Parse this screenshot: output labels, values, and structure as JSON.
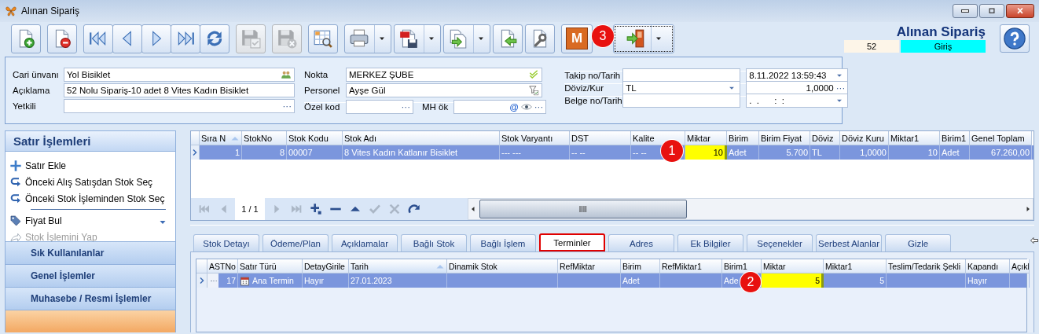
{
  "window": {
    "title": "Alınan Sipariş"
  },
  "toolbar": [
    [
      {
        "kind": "new",
        "disabled": false,
        "dropdown": false,
        "focused": false
      }
    ],
    [
      {
        "kind": "delete",
        "disabled": false,
        "dropdown": false,
        "focused": false
      }
    ],
    [
      {
        "kind": "first",
        "disabled": false,
        "dropdown": false,
        "focused": false
      },
      {
        "kind": "prev",
        "disabled": false,
        "dropdown": false,
        "focused": false
      },
      {
        "kind": "next",
        "disabled": false,
        "dropdown": false,
        "focused": false
      },
      {
        "kind": "last",
        "disabled": false,
        "dropdown": false,
        "focused": false
      },
      {
        "kind": "refresh",
        "disabled": false,
        "dropdown": false,
        "focused": false
      }
    ],
    [
      {
        "kind": "save",
        "disabled": true,
        "dropdown": false,
        "focused": false
      }
    ],
    [
      {
        "kind": "savex",
        "disabled": true,
        "dropdown": false,
        "focused": false
      }
    ],
    [
      {
        "kind": "report",
        "disabled": false,
        "dropdown": false,
        "focused": false
      }
    ],
    [
      {
        "kind": "print",
        "disabled": false,
        "dropdown": true,
        "focused": false
      }
    ],
    [
      {
        "kind": "pdf",
        "disabled": false,
        "dropdown": true,
        "focused": false
      }
    ],
    [
      {
        "kind": "export",
        "disabled": false,
        "dropdown": true,
        "focused": false
      }
    ],
    [
      {
        "kind": "import",
        "disabled": false,
        "dropdown": false,
        "focused": false
      }
    ],
    [
      {
        "kind": "tools",
        "disabled": false,
        "dropdown": false,
        "focused": false
      }
    ],
    [
      {
        "kind": "letter",
        "text": "M",
        "disabled": false,
        "dropdown": false,
        "focused": false
      }
    ],
    [
      {
        "kind": "exit",
        "disabled": false,
        "dropdown": true,
        "focused": true
      }
    ]
  ],
  "header": {
    "title": "Alınan Sipariş",
    "number": "52",
    "direction": "Giriş"
  },
  "form": {
    "columns": [
      {
        "rows": [
          {
            "label": "Cari ünvanı",
            "fields": [
              {
                "value": "Yol Bisiklet",
                "adornments": [
                  {
                    "kind": "people"
                  }
                ]
              }
            ]
          },
          {
            "label": "Açıklama",
            "fields": [
              {
                "value": "52 Nolu Sipariş-10 adet 8 Vites Kadın Bisiklet"
              }
            ]
          },
          {
            "label": "Yetkili",
            "fields": [
              {
                "adornments": [
                  {
                    "kind": "ellipsis",
                    "text": "···"
                  }
                ]
              }
            ]
          }
        ]
      },
      {
        "rows": [
          {
            "label": "Nokta",
            "fields": [
              {
                "value": "MERKEZ ŞUBE",
                "adornments": [
                  {
                    "kind": "check"
                  }
                ]
              }
            ]
          },
          {
            "label": "Personel",
            "fields": [
              {
                "value": "Ayşe Gül",
                "adornments": [
                  {
                    "kind": "filter"
                  }
                ]
              }
            ]
          },
          {
            "label": "Özel kod",
            "fields": [
              {
                "adornments": [
                  {
                    "kind": "ellipsis",
                    "text": "···"
                  }
                ]
              },
              {
                "label": "MH ök",
                "adornments": [
                  {
                    "kind": "at",
                    "text": "@"
                  },
                  {
                    "kind": "eye"
                  },
                  {
                    "kind": "ellipsis",
                    "text": "···"
                  }
                ]
              }
            ]
          }
        ]
      },
      {
        "rows": [
          {
            "label": "Takip no/Tarih",
            "fields": [
              {
                "kind": "text"
              },
              {
                "value": "8.11.2022 13:59:43",
                "adornments": [
                  {
                    "kind": "dropdown"
                  }
                ]
              }
            ]
          },
          {
            "label": "Döviz/Kur",
            "fields": [
              {
                "value": "TL",
                "adornments": [
                  {
                    "kind": "dropdown"
                  }
                ]
              },
              {
                "value": "1,0000",
                "kind": "number",
                "adornments": [
                  {
                    "kind": "ellipsis",
                    "text": "···"
                  }
                ]
              }
            ]
          },
          {
            "label": "Belge no/Tarih",
            "fields": [
              {
                "kind": "text"
              },
              {
                "value": ".  .      :  :",
                "adornments": [
                  {
                    "kind": "dropdown"
                  }
                ]
              }
            ]
          }
        ]
      }
    ]
  },
  "sidebar": {
    "title": "Satır İşlemleri",
    "item_groups": [
      [
        {
          "label": "Satır Ekle",
          "kind": "add",
          "disabled": false
        },
        {
          "label": "Önceki Alış Satışdan Stok Seç",
          "kind": "pick",
          "disabled": false
        },
        {
          "label": "Önceki Stok İşleminden Stok Seç",
          "kind": "pick",
          "disabled": false
        }
      ],
      [
        {
          "label": "Fiyat Bul",
          "kind": "price",
          "disabled": false
        },
        {
          "label": "Stok İşlemini Yap",
          "kind": "run",
          "disabled": true
        }
      ]
    ],
    "sections": [
      {
        "label": "Sık Kullanılanlar",
        "selected": false
      },
      {
        "label": "Genel İşlemler",
        "selected": false
      },
      {
        "label": "Muhasebe / Resmi İşlemler",
        "selected": false
      },
      {
        "selected": true
      }
    ]
  },
  "top_grid": {
    "columns": [
      {
        "label": "Sıra N",
        "kind": "number",
        "sorted": true
      },
      {
        "label": "StokNo",
        "kind": "number",
        "sorted": false
      },
      {
        "label": "Stok Kodu",
        "kind": "text",
        "sorted": false
      },
      {
        "label": "Stok Adı",
        "kind": "text",
        "sorted": false
      },
      {
        "label": "Stok Varyantı",
        "kind": "text",
        "sorted": false
      },
      {
        "label": "DST",
        "kind": "text",
        "sorted": false
      },
      {
        "label": "Kalite",
        "kind": "text",
        "sorted": false
      },
      {
        "label": "Miktar",
        "kind": "number",
        "sorted": false
      },
      {
        "label": "Birim",
        "kind": "text",
        "sorted": false
      },
      {
        "label": "Birim Fiyat",
        "kind": "number",
        "sorted": false
      },
      {
        "label": "Döviz",
        "kind": "text",
        "sorted": false
      },
      {
        "label": "Döviz Kuru",
        "kind": "number",
        "sorted": false
      },
      {
        "label": "Miktar1",
        "kind": "number",
        "sorted": false
      },
      {
        "label": "Birim1",
        "kind": "text",
        "sorted": false
      },
      {
        "label": "Genel Toplam",
        "kind": "number",
        "sorted": false
      }
    ],
    "rows": [
      {
        "selected": true,
        "cells": [
          {
            "text": "1",
            "highlighted": false
          },
          {
            "text": "8",
            "highlighted": false
          },
          {
            "text": "00007",
            "highlighted": false
          },
          {
            "text": "8 Vites Kadın Katlanır Bisiklet",
            "highlighted": false
          },
          {
            "text": "--- ---",
            "highlighted": false
          },
          {
            "text": "-- --",
            "highlighted": false
          },
          {
            "text": "-- --",
            "highlighted": false
          },
          {
            "text": "10",
            "highlighted": true
          },
          {
            "text": "Adet",
            "highlighted": false
          },
          {
            "text": "5.700",
            "highlighted": false
          },
          {
            "text": "TL",
            "highlighted": false
          },
          {
            "text": "1,0000",
            "highlighted": false
          },
          {
            "text": "10",
            "highlighted": false
          },
          {
            "text": "Adet",
            "highlighted": false
          },
          {
            "text": "67.260,00",
            "highlighted": false
          }
        ]
      }
    ],
    "navigator": [
      {
        "kind": "nfirst",
        "disabled": true
      },
      {
        "kind": "nprev",
        "disabled": true
      },
      {
        "kind": "page",
        "text": "1 / 1"
      },
      {
        "kind": "nnext",
        "disabled": true
      },
      {
        "kind": "nlast",
        "disabled": true
      },
      {
        "kind": "nappend",
        "disabled": false
      },
      {
        "kind": "nremove",
        "disabled": false
      },
      {
        "kind": "nup",
        "disabled": false
      },
      {
        "kind": "nconfirm",
        "disabled": true
      },
      {
        "kind": "ncancel",
        "disabled": true
      },
      {
        "kind": "nredo",
        "disabled": false
      }
    ]
  },
  "detail_tabs": [
    {
      "label": "Stok Detayı",
      "selected": false
    },
    {
      "label": "Ödeme/Plan",
      "selected": false
    },
    {
      "label": "Açıklamalar",
      "selected": false
    },
    {
      "label": "Bağlı Stok",
      "selected": false
    },
    {
      "label": "Bağlı İşlem",
      "selected": false
    },
    {
      "label": "Terminler",
      "selected": true
    },
    {
      "label": "Adres",
      "selected": false
    },
    {
      "label": "Ek Bilgiler",
      "selected": false
    },
    {
      "label": "Seçenekler",
      "selected": false
    },
    {
      "label": "Serbest Alanlar",
      "selected": false
    },
    {
      "label": "Gizle",
      "selected": false
    }
  ],
  "detail_grid": {
    "columns": [
      {
        "label": "ASTNo",
        "kind": "tree",
        "sorted": false
      },
      {
        "label": "Satır Türü",
        "kind": "entry-type",
        "sorted": false
      },
      {
        "label": "DetayGirile",
        "kind": "text",
        "sorted": false
      },
      {
        "label": "Tarih",
        "kind": "text",
        "sorted": true
      },
      {
        "label": "Dinamik Stok",
        "kind": "text",
        "sorted": false
      },
      {
        "label": "RefMiktar",
        "kind": "number",
        "sorted": false
      },
      {
        "label": "Birim",
        "kind": "text",
        "sorted": false
      },
      {
        "label": "RefMiktar1",
        "kind": "number",
        "sorted": false
      },
      {
        "label": "Birim1",
        "kind": "text",
        "sorted": false
      },
      {
        "label": "Miktar",
        "kind": "number",
        "sorted": false
      },
      {
        "label": "Miktar1",
        "kind": "number",
        "sorted": false
      },
      {
        "label": "Teslim/Tedarik Şekli",
        "kind": "text",
        "sorted": false
      },
      {
        "label": "Kapandı",
        "kind": "text",
        "sorted": false
      },
      {
        "label": "Açıkl",
        "kind": "text",
        "sorted": false
      }
    ],
    "rows": [
      {
        "selected": true,
        "cells": [
          {
            "text": "17",
            "highlighted": false
          },
          {
            "text": "Ana Termin",
            "highlighted": false
          },
          {
            "text": "Hayır",
            "highlighted": false
          },
          {
            "text": "27.01.2023",
            "highlighted": false
          },
          {
            "highlighted": false
          },
          {
            "highlighted": false
          },
          {
            "text": "Adet",
            "highlighted": false
          },
          {
            "highlighted": false
          },
          {
            "text": "Ade",
            "highlighted": false
          },
          {
            "text": "5",
            "highlighted": true
          },
          {
            "text": "5",
            "highlighted": false
          },
          {
            "highlighted": false
          },
          {
            "text": "Hayır",
            "highlighted": false
          },
          {
            "highlighted": false
          }
        ]
      }
    ]
  },
  "annotations": [
    {
      "text": "1"
    },
    {
      "text": "2"
    },
    {
      "text": "3"
    }
  ]
}
